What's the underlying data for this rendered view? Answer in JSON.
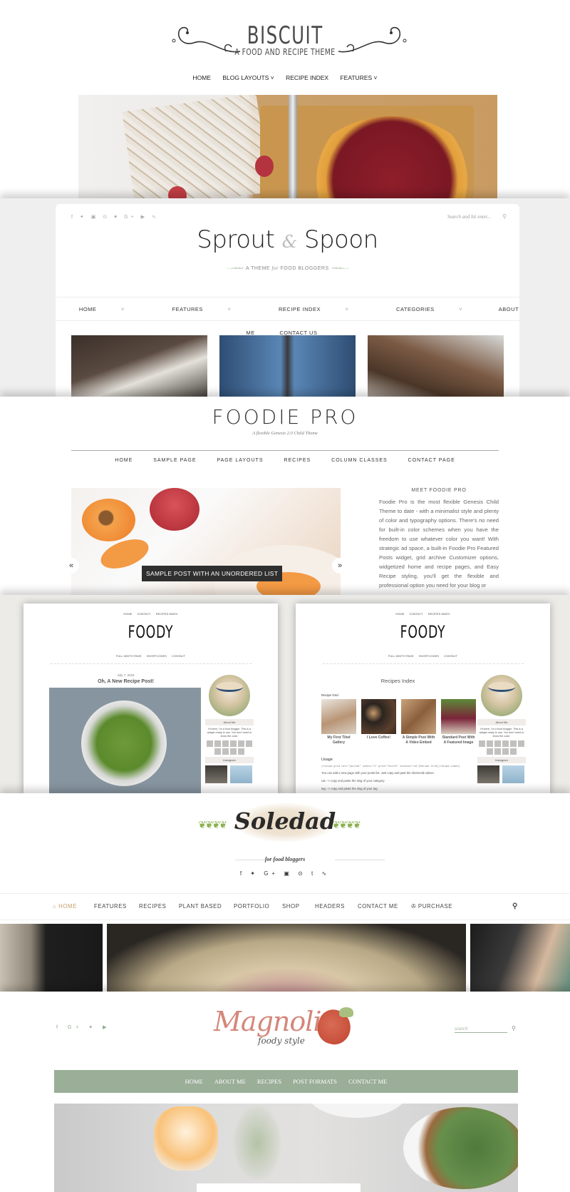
{
  "biscuit": {
    "title": "BISCUIT",
    "subtitle": "A FOOD AND RECIPE THEME",
    "nav": [
      "HOME",
      "BLOG LAYOUTS ˅",
      "RECIPE INDEX",
      "FEATURES ˅"
    ]
  },
  "sprout": {
    "social_icons": [
      "facebook-icon",
      "twitter-icon",
      "instagram-icon",
      "pinterest-icon",
      "heart-icon",
      "google-plus-icon",
      "youtube-icon",
      "rss-icon"
    ],
    "social_glyphs": "f ✦ ▣ ⊙ ♥ G+ ▶ ∿",
    "search_placeholder": "Search and hit enter...",
    "title_left": "Sprout",
    "title_amp": "&",
    "title_right": "Spoon",
    "tagline_pre": "A THEME",
    "tagline_italic": "for",
    "tagline_post": "FOOD BLOGGERS",
    "nav": [
      {
        "label": "HOME",
        "dropdown": true
      },
      {
        "label": "FEATURES",
        "dropdown": true
      },
      {
        "label": "RECIPE INDEX",
        "dropdown": true
      },
      {
        "label": "CATEGORIES",
        "dropdown": true
      },
      {
        "label": "ABOUT ME",
        "dropdown": false
      },
      {
        "label": "CONTACT US",
        "dropdown": false
      }
    ]
  },
  "foodie": {
    "title": "FOODIE PRO",
    "subtitle": "A flexible Genesis 2.0 Child Theme",
    "nav": [
      "HOME",
      "SAMPLE PAGE",
      "PAGE LAYOUTS",
      "RECIPES",
      "COLUMN CLASSES",
      "CONTACT PAGE"
    ],
    "slider_caption": "SAMPLE POST WITH AN UNORDERED LIST",
    "prev": "«",
    "next": "»",
    "sidebar_heading": "MEET FOODIE PRO",
    "sidebar_text": "Foodie Pro is the most flexible Genesis Child Theme to date - with a minimalist style and plenty of color and typography options. There's no need for built-in color schemes when you have the freedom to use whatever color you want! With strategic ad space, a built-in Foodie Pro Featured Posts widget, grid archive Customizer options, widgetized home and recipe pages, and Easy Recipe styling, you'll get the flexible and professional option you need for your blog or"
  },
  "foody": {
    "top_nav": [
      "HOME",
      "CONTACT",
      "RECIPES INDEX"
    ],
    "logo": "FOODY",
    "sub_nav": [
      "FULL WIDTH PAGE",
      "SHORTCODES",
      "CONTACT"
    ],
    "left": {
      "date": "July 7, 2015",
      "post_title": "Oh, A New Recipe Post!"
    },
    "right": {
      "page_title": "Recipes Index",
      "grid_label": "Recipe Grid",
      "grid_items": [
        "My First Tiled Gallery",
        "I Love Coffee!",
        "A Simple Post With A Video Embed",
        "Standard Post With A Featured Image"
      ],
      "usage_heading": "Usage",
      "usage_code": "[recipe-grid cat=\"journal\" posts=\"4\" grid=\"fourth\" excerpt=\"no\"]Recipe Grid[/recipe-index]",
      "usage_lines": [
        "You can add a new page with your posts list. Just copy and past the shortcode above.",
        "cat --> copy and paste the slug of your category",
        "tag --> copy and paste the slug of your tag"
      ]
    },
    "sidebar": {
      "about_heading": "About Me",
      "about_text": "Hi there, I'm a food blogger. This is a widget ready to use. You don't need to know the code.",
      "instagram_heading": "Instagram"
    }
  },
  "soledad": {
    "logo": "Soledad",
    "tagline": "for food bloggers",
    "social_glyphs": "f ✦ G+ ▣ ⊙ t ∿",
    "nav": [
      "HOME",
      "FEATURES",
      "RECIPES",
      "PLANT BASED",
      "PORTFOLIO",
      "SHOP",
      "HEADERS",
      "CONTACT ME",
      "PURCHASE"
    ],
    "home_icon": "⌂",
    "cart_icon": "✇",
    "accent": "#c79d6a"
  },
  "magnolia": {
    "social_glyphs": "f G+ ✦ ▶",
    "logo": "Magnolia",
    "logo_sub": "foody style",
    "search_placeholder": "search",
    "nav": [
      "HOME",
      "ABOUT ME",
      "RECIPES",
      "POST FORMATS",
      "CONTACT ME"
    ],
    "nav_color": "#9aae98"
  }
}
